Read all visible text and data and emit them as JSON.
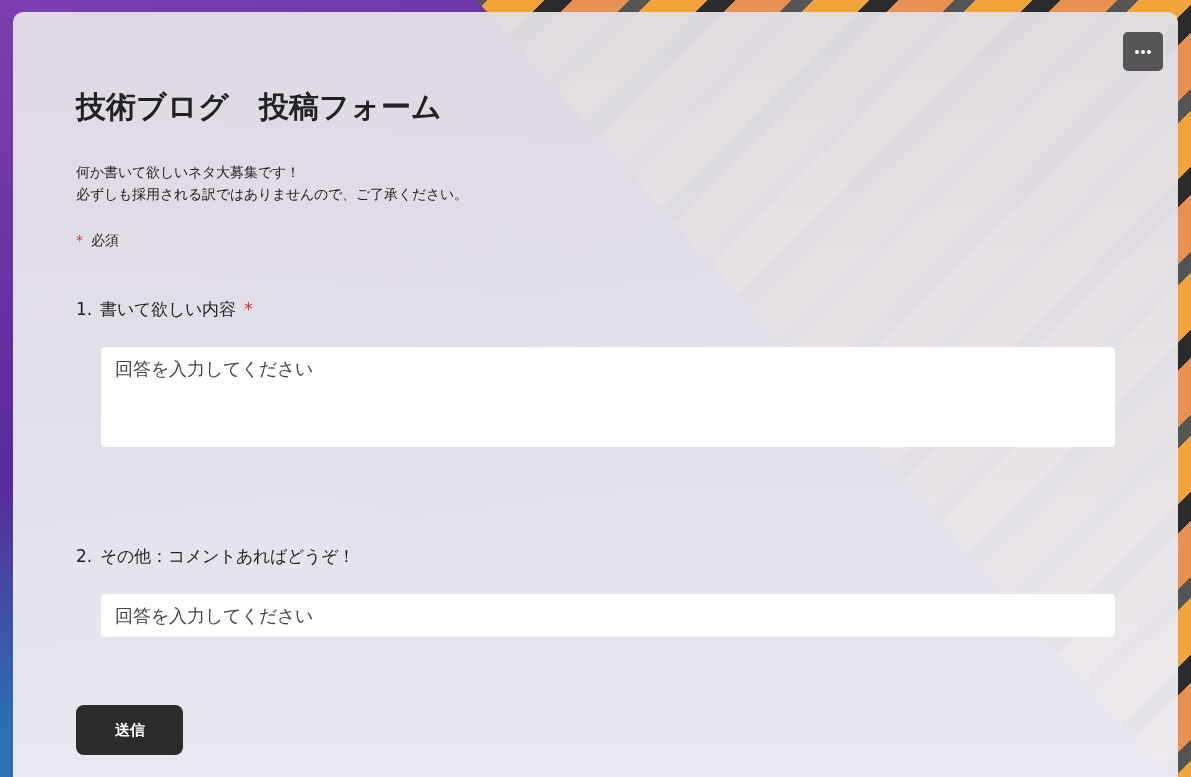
{
  "form": {
    "title": "技術ブログ　投稿フォーム",
    "description": [
      "何か書いて欲しいネタ大募集です！",
      "必ずしも採用される訳ではありませんので、ご了承ください。"
    ],
    "required_legend": {
      "mark": "*",
      "label": "必須"
    },
    "questions": [
      {
        "number": "1.",
        "text": "書いて欲しい内容",
        "required": true,
        "kind": "multiline",
        "placeholder": "回答を入力してください"
      },
      {
        "number": "2.",
        "text": "その他：コメントあればどうぞ！",
        "required": false,
        "kind": "single",
        "placeholder": "回答を入力してください"
      }
    ],
    "submit": "送信"
  }
}
